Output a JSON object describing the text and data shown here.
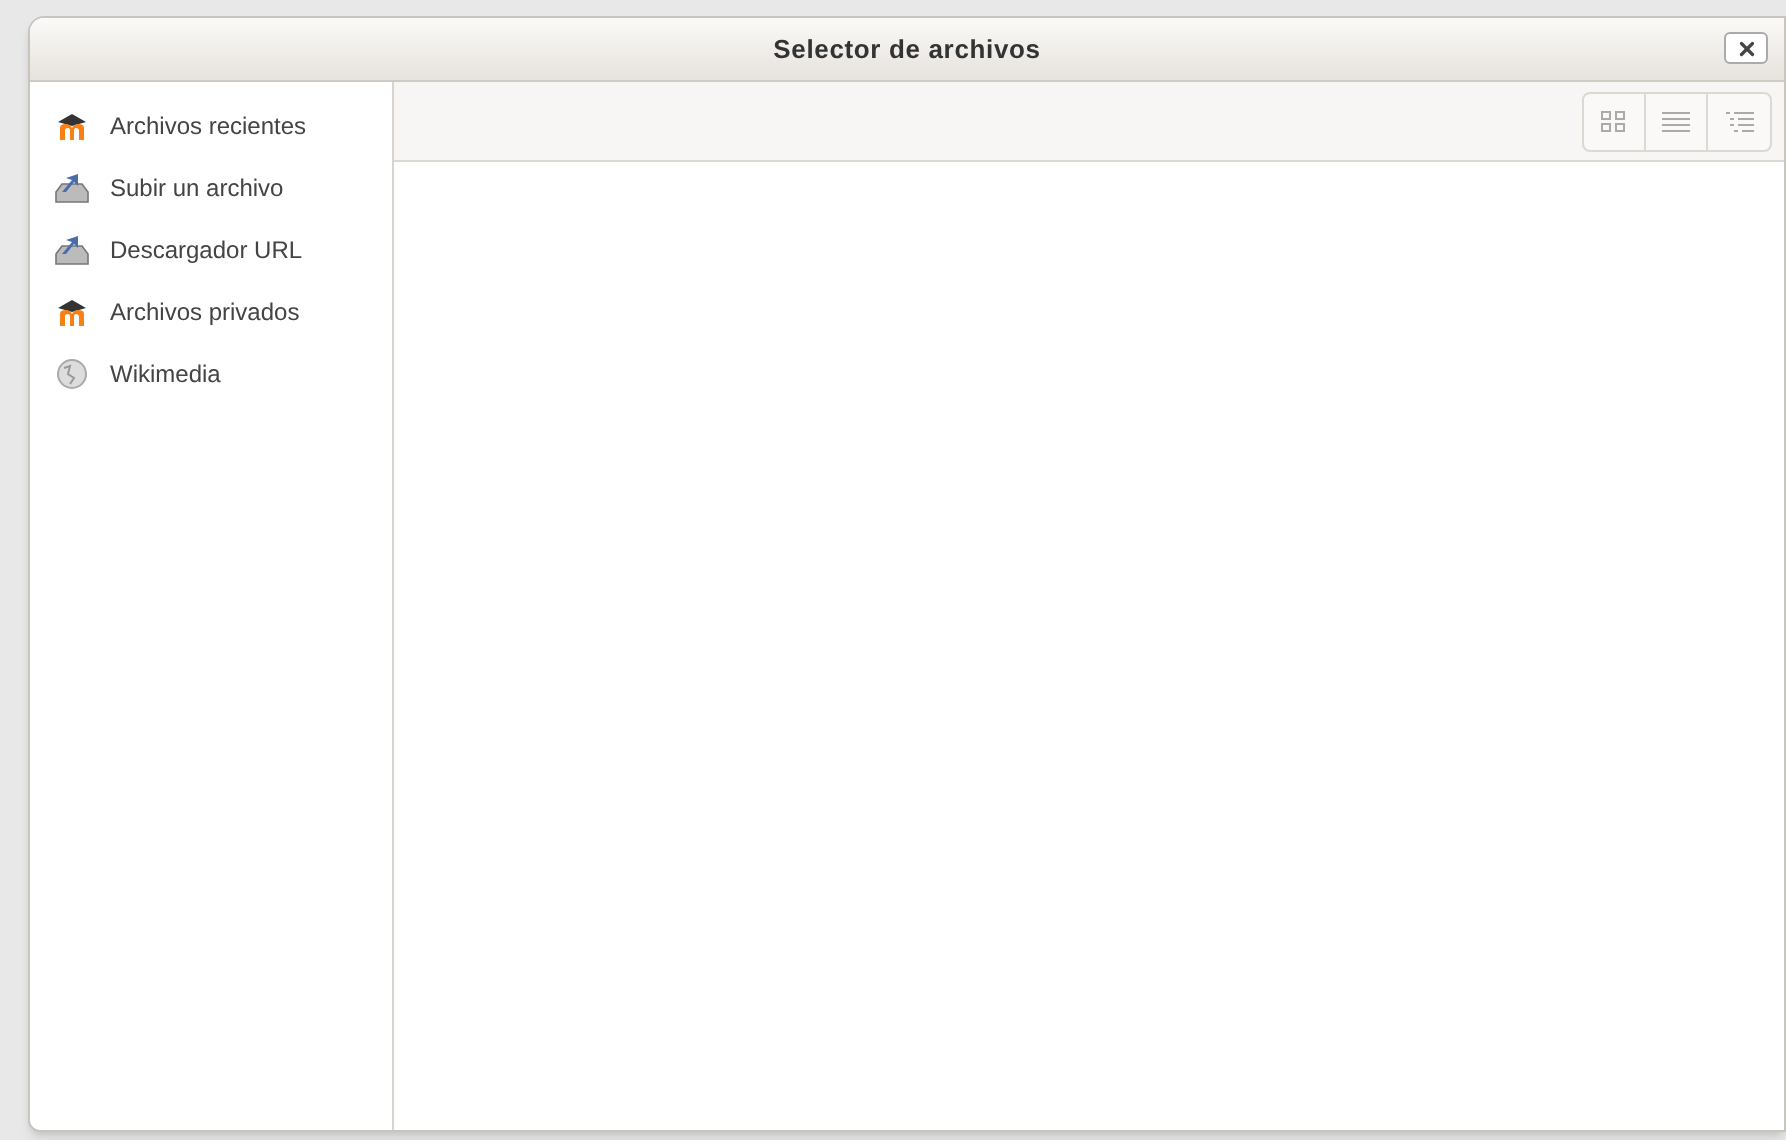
{
  "window": {
    "title": "Selector de archivos"
  },
  "sidebar": {
    "items": [
      {
        "label": "Archivos recientes",
        "kind": "moodle"
      },
      {
        "label": "Subir un archivo",
        "kind": "upload"
      },
      {
        "label": "Descargador URL",
        "kind": "upload"
      },
      {
        "label": "Archivos privados",
        "kind": "moodle"
      },
      {
        "label": "Wikimedia",
        "kind": "wikimedia"
      }
    ]
  }
}
